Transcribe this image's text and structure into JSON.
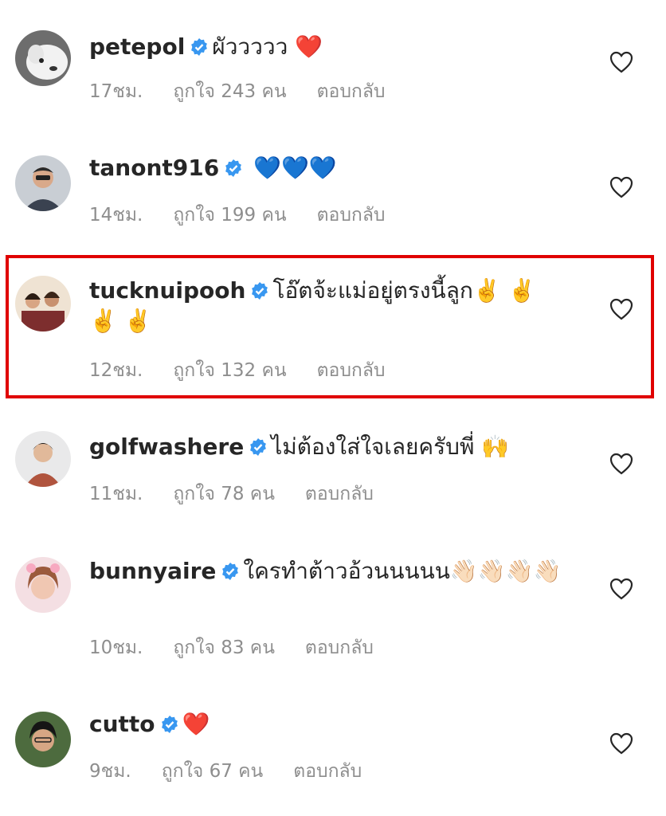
{
  "comments": [
    {
      "username": "petepol",
      "text": "ผัววววว",
      "emoji": "❤️",
      "time": "17ชม.",
      "likes": "ถูกใจ 243 คน",
      "reply": "ตอบกลับ"
    },
    {
      "username": "tanont916",
      "text": "",
      "emoji": "💙💙💙",
      "time": "14ชม.",
      "likes": "ถูกใจ 199 คน",
      "reply": "ตอบกลับ"
    },
    {
      "username": "tucknuipooh",
      "text": "โอ๊ตจ้ะแม่อยู่ตรงนี้ลูก",
      "emoji": "✌️ ✌️ ✌️ ✌️",
      "time": "12ชม.",
      "likes": "ถูกใจ 132 คน",
      "reply": "ตอบกลับ"
    },
    {
      "username": "golfwashere",
      "text": "ไม่ต้องใส่ใจเลยครับพี่",
      "emoji": "🙌",
      "time": "11ชม.",
      "likes": "ถูกใจ 78 คน",
      "reply": "ตอบกลับ"
    },
    {
      "username": "bunnyaire",
      "text": "ใครทำต้าวอ้วนนนนน",
      "emoji": "👋🏻👋🏻👋🏻👋🏻",
      "time": "10ชม.",
      "likes": "ถูกใจ 83 คน",
      "reply": "ตอบกลับ"
    },
    {
      "username": "cutto",
      "text": "",
      "emoji": "❤️",
      "time": "9ชม.",
      "likes": "ถูกใจ 67 คน",
      "reply": "ตอบกลับ"
    }
  ],
  "colors": {
    "highlight": "#e00000",
    "verified": "#3897f0",
    "meta": "#8e8e8e"
  },
  "icons": {
    "verified": "verified-badge-icon",
    "like": "heart-outline-icon"
  }
}
